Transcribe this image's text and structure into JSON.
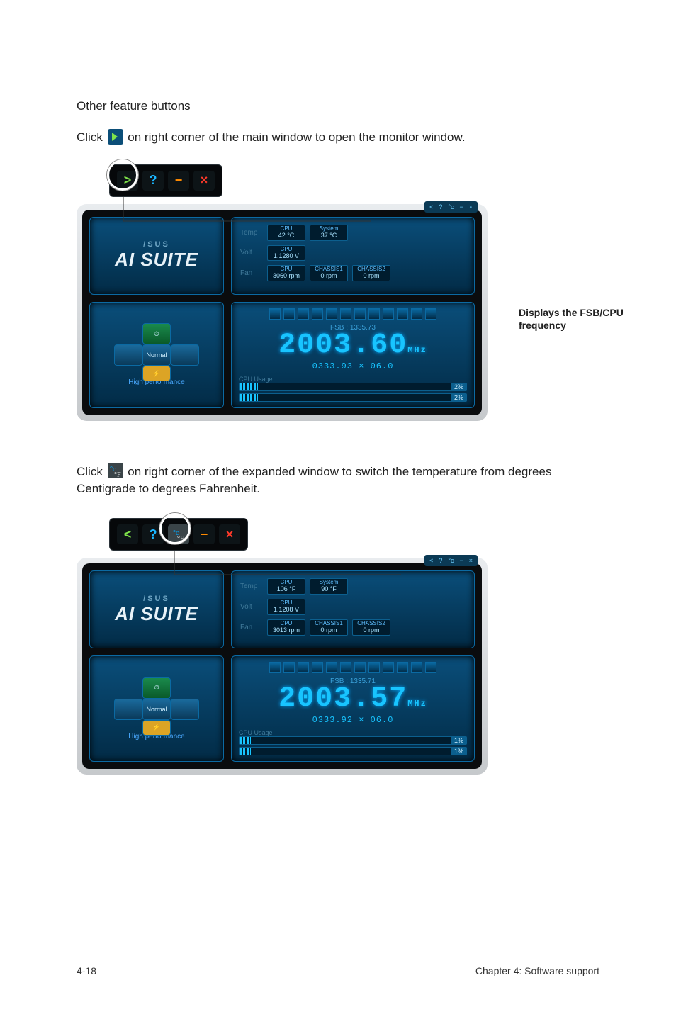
{
  "heading": "Other feature buttons",
  "instr1_pre": "Click ",
  "instr1_post": " on right corner of the main window to open the monitor window.",
  "instr2_pre": "Click ",
  "instr2_post": " on right corner of the expanded window to switch the temperature from degrees Centigrade to degrees Fahrenheit.",
  "callout1": "Displays the FSB/CPU frequency",
  "toolbar1": {
    "expand": ">",
    "help": "?",
    "min": "−",
    "close": "×"
  },
  "toolbar2": {
    "back": "<",
    "help": "?",
    "cf": "°c/°F",
    "min": "−",
    "close": "×"
  },
  "panel_tabs": [
    "<",
    "?",
    "°c",
    "−",
    "×"
  ],
  "logo": {
    "brand": "/SUS",
    "product": "AI SUITE"
  },
  "mode": {
    "top_icon": "⏱",
    "center": "Normal",
    "bottom": "⚡",
    "label": "High performance"
  },
  "panel1": {
    "temp_label": "Temp",
    "volt_label": "Volt",
    "fan_label": "Fan",
    "temp": [
      {
        "name": "CPU",
        "value": "42 °C"
      },
      {
        "name": "System",
        "value": "37 °C"
      }
    ],
    "volt": [
      {
        "name": "CPU",
        "value": "1.1280 V"
      }
    ],
    "fan": [
      {
        "name": "CPU",
        "value": "3060 rpm"
      },
      {
        "name": "CHASSIS1",
        "value": "0 rpm"
      },
      {
        "name": "CHASSIS2",
        "value": "0 rpm"
      }
    ],
    "fsb": "FSB : 1335.73",
    "freq": "2003.60",
    "mhz": "MHz",
    "sub": "0333.93 × 06.0",
    "usage_label": "CPU Usage",
    "bars": [
      {
        "pct": "2%"
      },
      {
        "pct": "2%"
      }
    ]
  },
  "panel2": {
    "temp_label": "Temp",
    "volt_label": "Volt",
    "fan_label": "Fan",
    "temp": [
      {
        "name": "CPU",
        "value": "106 °F"
      },
      {
        "name": "System",
        "value": "90 °F"
      }
    ],
    "volt": [
      {
        "name": "CPU",
        "value": "1.1208 V"
      }
    ],
    "fan": [
      {
        "name": "CPU",
        "value": "3013 rpm"
      },
      {
        "name": "CHASSIS1",
        "value": "0 rpm"
      },
      {
        "name": "CHASSIS2",
        "value": "0 rpm"
      }
    ],
    "fsb": "FSB : 1335.71",
    "freq": "2003.57",
    "mhz": "MHz",
    "sub": "0333.92 × 06.0",
    "usage_label": "CPU Usage",
    "bars": [
      {
        "pct": "1%"
      },
      {
        "pct": "1%"
      }
    ]
  },
  "footer": {
    "left": "4-18",
    "right": "Chapter 4: Software support"
  }
}
